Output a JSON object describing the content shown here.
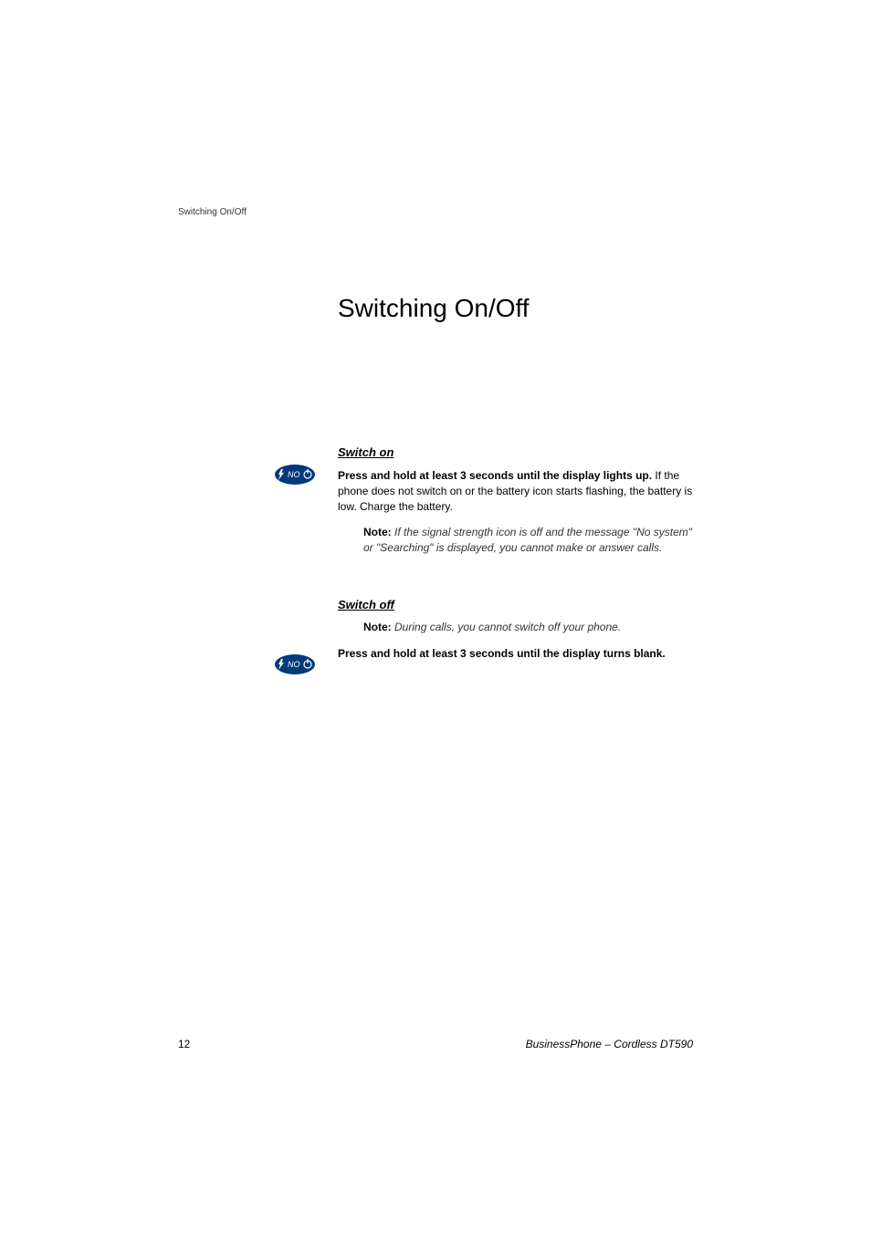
{
  "header": {
    "section_label": "Switching On/Off"
  },
  "title": "Switching On/Off",
  "icon": {
    "label": "NO"
  },
  "switch_on": {
    "heading": "Switch on",
    "bold_line": "Press and hold at least 3 seconds until the display lights up.",
    "body": "If the phone does not switch on or the battery icon starts flashing, the battery is low. Charge the battery.",
    "note_label": "Note:",
    "note_text": "If the signal strength icon is off and the message \"No system\" or \"Searching\" is displayed, you cannot make or answer calls."
  },
  "switch_off": {
    "heading": "Switch off",
    "note_label": "Note:",
    "note_text": "During calls, you cannot switch off your phone.",
    "instruction": "Press and hold at least 3 seconds until the display turns blank."
  },
  "footer": {
    "page_number": "12",
    "document_title": "BusinessPhone – Cordless DT590"
  }
}
